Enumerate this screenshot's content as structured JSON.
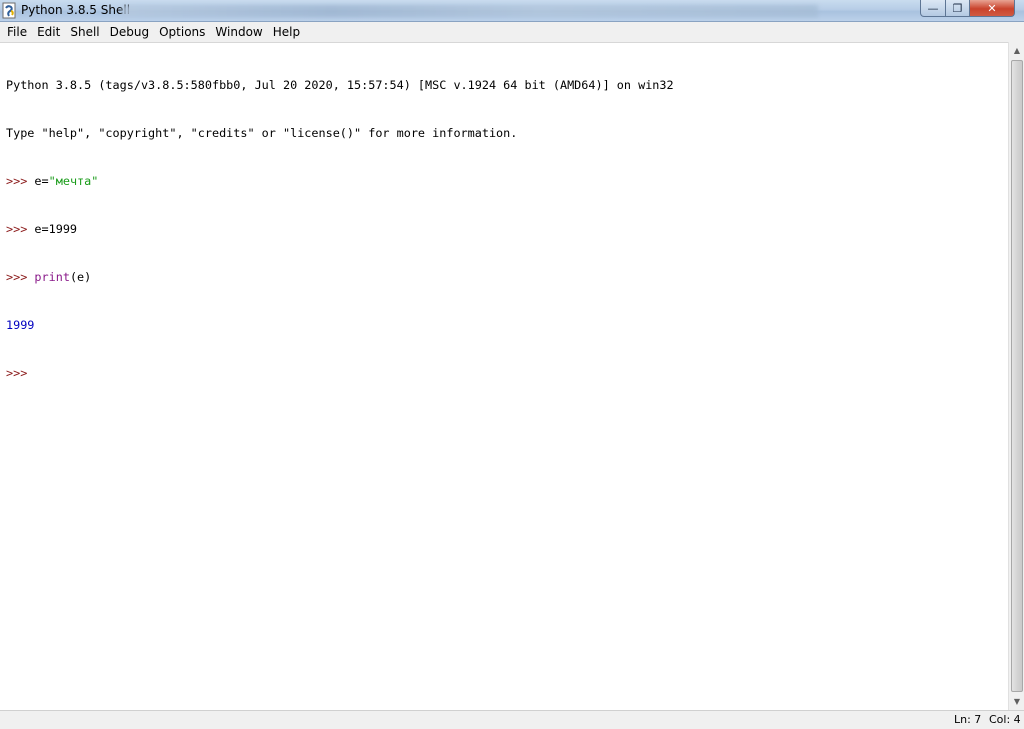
{
  "window": {
    "title": "Python 3.8.5 Shell",
    "buttons": {
      "minimize": "—",
      "maximize": "❐",
      "close": "✕"
    }
  },
  "menu": {
    "items": [
      "File",
      "Edit",
      "Shell",
      "Debug",
      "Options",
      "Window",
      "Help"
    ]
  },
  "shell": {
    "banner_line1": "Python 3.8.5 (tags/v3.8.5:580fbb0, Jul 20 2020, 15:57:54) [MSC v.1924 64 bit (AMD64)] on win32",
    "banner_line2": "Type \"help\", \"copyright\", \"credits\" or \"license()\" for more information.",
    "prompt": ">>> ",
    "cmd1_prefix": "e=",
    "cmd1_string": "\"мечта\"",
    "cmd2": "e=1999",
    "cmd3_builtin": "print",
    "cmd3_args": "(e)",
    "output": "1999",
    "final_prompt": ">>>"
  },
  "status": {
    "ln": "Ln: 7",
    "col": "Col: 4"
  },
  "colors": {
    "prompt": "#8b1a1a",
    "string": "#1a9c1a",
    "builtin": "#8a1a8a",
    "output": "#0000c0"
  },
  "icons": {
    "app": "python-idle-icon",
    "scroll_up": "arrow-up-icon",
    "scroll_down": "arrow-down-icon"
  }
}
